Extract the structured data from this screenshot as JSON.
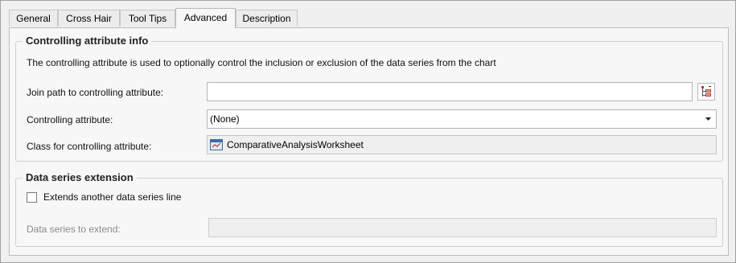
{
  "tabs": [
    {
      "label": "General"
    },
    {
      "label": "Cross Hair"
    },
    {
      "label": "Tool Tips"
    },
    {
      "label": "Advanced",
      "active": true
    },
    {
      "label": "Description"
    }
  ],
  "controlling": {
    "legend": "Controlling attribute info",
    "description": "The controlling attribute is used to optionally control the inclusion or exclusion of the data series from the chart",
    "join_path_label": "Join path to controlling attribute:",
    "join_path_value": "",
    "join_path_button_icon": "tree-picker-icon",
    "attribute_label": "Controlling attribute:",
    "attribute_value": "(None)",
    "class_label": "Class for controlling attribute:",
    "class_value": "ComparativeAnalysisWorksheet",
    "class_icon": "worksheet-class-icon"
  },
  "extension": {
    "legend": "Data series extension",
    "checkbox_label": "Extends another data series line",
    "checked": false,
    "series_label": "Data series to extend:",
    "series_value": ""
  },
  "colors": {
    "accent": "#c0392b",
    "panel": "#f7f7f7",
    "disabled_text": "#8a8a8a"
  }
}
